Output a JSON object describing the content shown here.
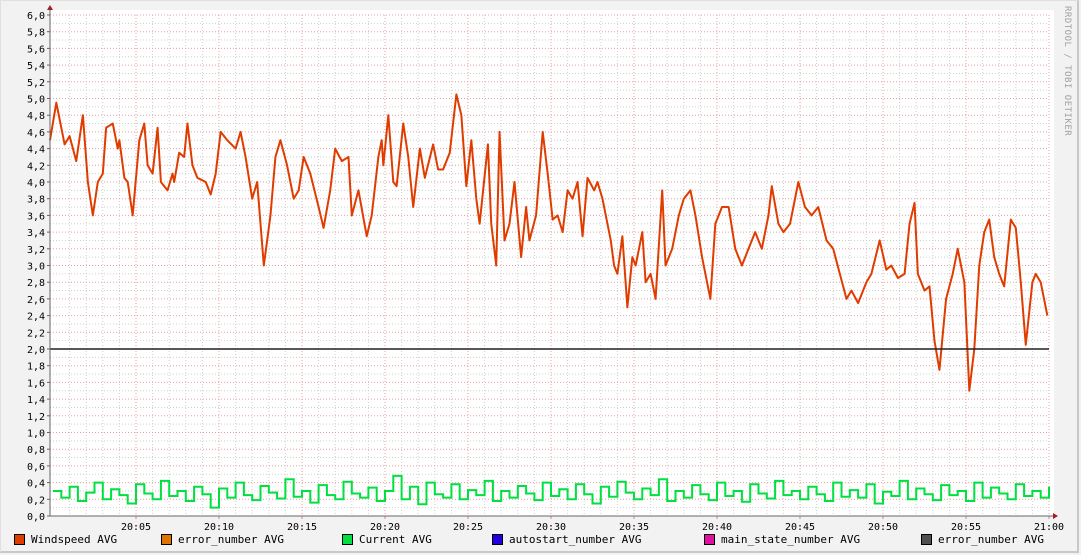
{
  "watermark": "RRDTOOL / TOBI OETIKER",
  "legend": [
    {
      "label": "Windspeed AVG",
      "color": "#e03c00"
    },
    {
      "label": "error_number AVG",
      "color": "#e07400"
    },
    {
      "label": "Current AVG",
      "color": "#00e040"
    },
    {
      "label": "autostart_number AVG",
      "color": "#2000e0"
    },
    {
      "label": "main_state_number AVG",
      "color": "#e010a0"
    },
    {
      "label": "error_number AVG",
      "color": "#505050"
    }
  ],
  "chart_data": {
    "type": "line",
    "title": "",
    "xlabel": "",
    "ylabel": "",
    "x_unit": "minutes after 20:00",
    "xlim": [
      -0.2,
      60
    ],
    "ylim": [
      0,
      6
    ],
    "y_ticks": [
      "0,0",
      "0,2",
      "0,4",
      "0,6",
      "0,8",
      "1,0",
      "1,2",
      "1,4",
      "1,6",
      "1,8",
      "2,0",
      "2,2",
      "2,4",
      "2,6",
      "2,8",
      "3,0",
      "3,2",
      "3,4",
      "3,6",
      "3,8",
      "4,0",
      "4,2",
      "4,4",
      "4,6",
      "4,8",
      "5,0",
      "5,2",
      "5,4",
      "5,6",
      "5,8",
      "6,0"
    ],
    "x_ticks": [
      {
        "t": 5,
        "label": "20:05"
      },
      {
        "t": 10,
        "label": "20:10"
      },
      {
        "t": 15,
        "label": "20:15"
      },
      {
        "t": 20,
        "label": "20:20"
      },
      {
        "t": 25,
        "label": "20:25"
      },
      {
        "t": 30,
        "label": "20:30"
      },
      {
        "t": 35,
        "label": "20:35"
      },
      {
        "t": 40,
        "label": "20:40"
      },
      {
        "t": 45,
        "label": "20:45"
      },
      {
        "t": 50,
        "label": "20:50"
      },
      {
        "t": 55,
        "label": "20:55"
      },
      {
        "t": 60,
        "label": "21:00"
      }
    ],
    "grid": true,
    "hrule": {
      "value": 2.0,
      "color": "#202020"
    },
    "series": [
      {
        "name": "Windspeed AVG",
        "color": "#e03c00",
        "t": [
          -0.2,
          0.2,
          0.7,
          1.0,
          1.4,
          1.8,
          2.1,
          2.4,
          2.7,
          3.0,
          3.2,
          3.6,
          3.9,
          4.0,
          4.3,
          4.5,
          4.8,
          5.2,
          5.5,
          5.7,
          6.0,
          6.3,
          6.5,
          6.9,
          7.2,
          7.3,
          7.6,
          7.9,
          8.1,
          8.4,
          8.7,
          9.2,
          9.5,
          9.8,
          10.1,
          10.5,
          11.0,
          11.3,
          11.6,
          12.0,
          12.3,
          12.7,
          13.1,
          13.4,
          13.7,
          14.1,
          14.5,
          14.8,
          15.1,
          15.5,
          16.0,
          16.3,
          16.7,
          17.0,
          17.4,
          17.8,
          18.0,
          18.4,
          18.9,
          19.2,
          19.6,
          19.8,
          19.9,
          20.2,
          20.5,
          20.7,
          21.1,
          21.4,
          21.7,
          22.1,
          22.4,
          22.9,
          23.2,
          23.5,
          23.9,
          24.3,
          24.6,
          24.9,
          25.2,
          25.5,
          25.7,
          26.2,
          26.4,
          26.7,
          26.9,
          27.2,
          27.5,
          27.8,
          28.2,
          28.5,
          28.7,
          29.1,
          29.5,
          29.8,
          30.1,
          30.4,
          30.7,
          31.0,
          31.3,
          31.6,
          31.9,
          32.2,
          32.6,
          32.8,
          33.1,
          33.6,
          33.8,
          34.0,
          34.3,
          34.6,
          34.9,
          35.1,
          35.5,
          35.7,
          36.0,
          36.3,
          36.7,
          36.9,
          37.3,
          37.7,
          38.0,
          38.4,
          38.7,
          39.1,
          39.3,
          39.6,
          39.9,
          40.3,
          40.7,
          41.1,
          41.5,
          41.9,
          42.3,
          42.7,
          43.1,
          43.3,
          43.7,
          44.0,
          44.4,
          44.9,
          45.3,
          45.7,
          46.1,
          46.6,
          47.0,
          47.4,
          47.8,
          48.1,
          48.5,
          49.0,
          49.3,
          49.8,
          50.2,
          50.5,
          50.9,
          51.3,
          51.6,
          51.9,
          52.1,
          52.5,
          52.8,
          53.1,
          53.4,
          53.8,
          54.2,
          54.5,
          54.9,
          55.2,
          55.5,
          55.8,
          56.1,
          56.4,
          56.7,
          57.0,
          57.3,
          57.7,
          58.0,
          58.3,
          58.6,
          59.0,
          59.2,
          59.5,
          59.9
        ],
        "values": [
          4.5,
          4.95,
          4.45,
          4.55,
          4.25,
          4.8,
          4.0,
          3.6,
          4.0,
          4.1,
          4.65,
          4.7,
          4.4,
          4.5,
          4.05,
          4.0,
          3.6,
          4.5,
          4.7,
          4.2,
          4.1,
          4.65,
          4.0,
          3.9,
          4.1,
          4.0,
          4.35,
          4.3,
          4.7,
          4.2,
          4.05,
          4.0,
          3.85,
          4.1,
          4.6,
          4.5,
          4.4,
          4.6,
          4.3,
          3.8,
          4.0,
          3.0,
          3.6,
          4.3,
          4.5,
          4.2,
          3.8,
          3.9,
          4.3,
          4.1,
          3.7,
          3.45,
          3.9,
          4.4,
          4.25,
          4.3,
          3.6,
          3.9,
          3.35,
          3.6,
          4.3,
          4.5,
          4.2,
          4.8,
          4.0,
          3.95,
          4.7,
          4.3,
          3.7,
          4.4,
          4.05,
          4.45,
          4.15,
          4.15,
          4.35,
          5.05,
          4.8,
          3.95,
          4.5,
          3.8,
          3.5,
          4.45,
          3.5,
          3.0,
          4.6,
          3.3,
          3.5,
          4.0,
          3.1,
          3.7,
          3.3,
          3.6,
          4.6,
          4.1,
          3.55,
          3.6,
          3.4,
          3.9,
          3.8,
          4.0,
          3.35,
          4.05,
          3.9,
          4.0,
          3.8,
          3.3,
          3.0,
          2.9,
          3.35,
          2.5,
          3.1,
          3.0,
          3.4,
          2.8,
          2.9,
          2.6,
          3.9,
          3.0,
          3.2,
          3.6,
          3.8,
          3.9,
          3.6,
          3.1,
          2.9,
          2.6,
          3.5,
          3.7,
          3.7,
          3.2,
          3.0,
          3.2,
          3.4,
          3.2,
          3.6,
          3.95,
          3.5,
          3.4,
          3.5,
          4.0,
          3.7,
          3.6,
          3.7,
          3.3,
          3.2,
          2.9,
          2.6,
          2.7,
          2.55,
          2.8,
          2.9,
          3.3,
          2.95,
          3.0,
          2.85,
          2.9,
          3.5,
          3.75,
          2.9,
          2.7,
          2.75,
          2.1,
          1.75,
          2.6,
          2.9,
          3.2,
          2.8,
          1.5,
          2.0,
          3.0,
          3.4,
          3.55,
          3.1,
          2.9,
          2.75,
          3.55,
          3.45,
          2.8,
          2.05,
          2.8,
          2.9,
          2.8,
          2.4
        ]
      },
      {
        "name": "Current AVG",
        "color": "#00e040",
        "t_start": 0,
        "t_step": 0.5,
        "values": [
          0.3,
          0.22,
          0.35,
          0.18,
          0.28,
          0.4,
          0.2,
          0.32,
          0.25,
          0.15,
          0.38,
          0.27,
          0.2,
          0.42,
          0.24,
          0.3,
          0.18,
          0.35,
          0.26,
          0.1,
          0.33,
          0.22,
          0.4,
          0.25,
          0.19,
          0.36,
          0.28,
          0.21,
          0.44,
          0.23,
          0.3,
          0.16,
          0.37,
          0.25,
          0.2,
          0.41,
          0.27,
          0.22,
          0.34,
          0.18,
          0.3,
          0.48,
          0.2,
          0.35,
          0.14,
          0.4,
          0.26,
          0.22,
          0.38,
          0.2,
          0.31,
          0.25,
          0.42,
          0.18,
          0.3,
          0.22,
          0.36,
          0.27,
          0.19,
          0.4,
          0.24,
          0.32,
          0.2,
          0.38,
          0.26,
          0.15,
          0.35,
          0.23,
          0.41,
          0.28,
          0.2,
          0.33,
          0.25,
          0.44,
          0.18,
          0.3,
          0.22,
          0.37,
          0.26,
          0.19,
          0.4,
          0.24,
          0.3,
          0.17,
          0.38,
          0.27,
          0.21,
          0.42,
          0.25,
          0.3,
          0.2,
          0.35,
          0.26,
          0.18,
          0.4,
          0.23,
          0.31,
          0.22,
          0.38,
          0.15,
          0.29,
          0.24,
          0.42,
          0.2,
          0.33,
          0.26,
          0.19,
          0.37,
          0.25,
          0.3,
          0.18,
          0.4,
          0.22,
          0.34,
          0.27,
          0.2,
          0.38,
          0.24,
          0.3,
          0.22,
          0.35
        ]
      }
    ]
  }
}
